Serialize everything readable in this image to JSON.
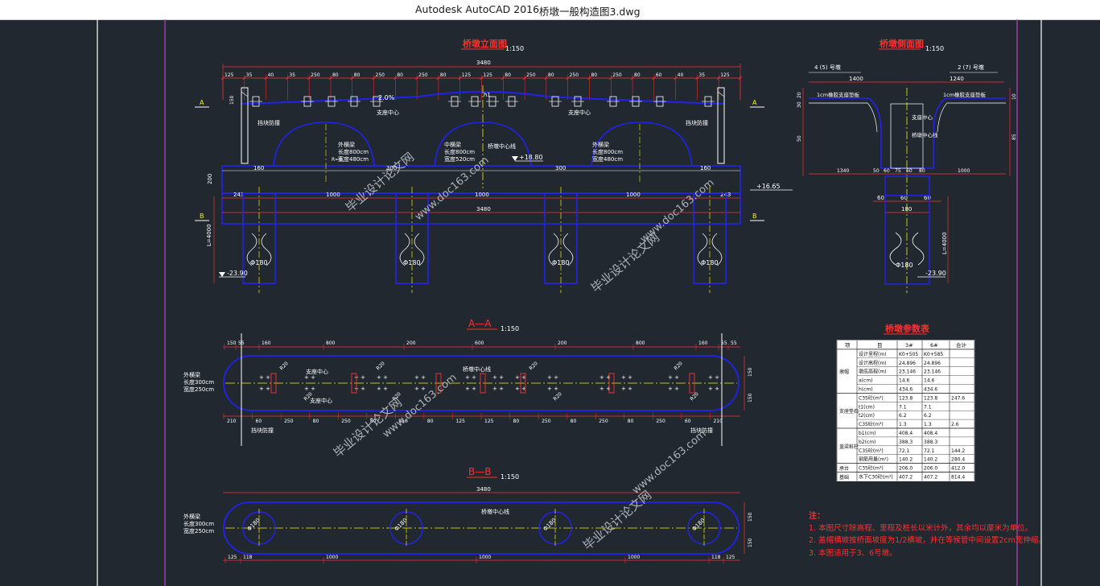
{
  "window": {
    "app_title": "Autodesk AutoCAD 2016",
    "file_name": "桥墩一般构造图3.dwg"
  },
  "drawing": {
    "front_view": {
      "title": "桥墩立面图",
      "scale": "1:150",
      "overall": "3480",
      "top_dims": [
        "125",
        "35",
        "40",
        "35",
        "250",
        "80",
        "80",
        "250",
        "80",
        "250",
        "80",
        "125",
        "125",
        "80",
        "250",
        "80",
        "250",
        "80",
        "250",
        "80",
        "60",
        "40",
        "35",
        "125"
      ],
      "beam_dims": [
        "160",
        "300",
        "300",
        "160"
      ],
      "bent_dims": [
        "243",
        "1000",
        "1000",
        "1000",
        "243"
      ],
      "overall_bottom": "3480",
      "slope": "2.0%",
      "elev_top": "+18.80",
      "elev_cap": "+16.65",
      "elev_bottom": "-23.90",
      "pile_length": "L=4000",
      "pile_dia": [
        "Φ180",
        "Φ180",
        "Φ180",
        "Φ180"
      ],
      "cap_height": "200",
      "left_dims": [
        "150",
        "200"
      ],
      "labels": {
        "guard_wall": "挡块防撞",
        "guard_wall_r": "挡块防撞",
        "support_center": "支座中心",
        "support_center_r": "支座中心",
        "pier_center": "桥墩中心线",
        "radius": "R=8",
        "bearing_a": [
          "外横梁",
          "长度800cm",
          "宽度480cm"
        ],
        "bearing_b": [
          "中横梁",
          "长度800cm",
          "宽度520cm"
        ],
        "bearing_c": [
          "外横梁",
          "长度800cm",
          "宽度480cm"
        ],
        "h1": "h1",
        "h2": "h2"
      },
      "section_marks": [
        "A",
        "A",
        "B",
        "B"
      ]
    },
    "side_view": {
      "title": "桥墩侧面图",
      "scale": "1:150",
      "left_note": "4 (5) 号墩",
      "right_note": "2 (7) 号墩",
      "top_dims": [
        "1400",
        "1240"
      ],
      "pad_left": "1cm橡胶支座垫板",
      "pad_right": "1cm橡胶支座垫板",
      "support": "支座中心",
      "pier": "桥墩中心线",
      "bottom_dims": [
        "1340",
        "50",
        "60",
        "75",
        "60",
        "80",
        "1000"
      ],
      "cap_dims": [
        "60",
        "60",
        "60"
      ],
      "pile_dim": "180",
      "heights": [
        "30",
        "20",
        "10",
        "50",
        "85"
      ],
      "pile_length": "L=4000",
      "pile_dia": "Φ180",
      "elev_bottom": "-23.90"
    },
    "section_aa": {
      "title": "A—A",
      "scale": "1:150",
      "top_dims": [
        "150",
        "55",
        "160",
        "800",
        "200",
        "600",
        "200",
        "800",
        "160",
        "55",
        "55"
      ],
      "bottom_dims": [
        "210",
        "60",
        "250",
        "80",
        "250",
        "80",
        "250",
        "80",
        "125",
        "125",
        "80",
        "250",
        "80",
        "250",
        "80",
        "250",
        "60",
        "210"
      ],
      "side_dims": [
        "150",
        "150"
      ],
      "radius": [
        "R20",
        "R20",
        "R20",
        "R20",
        "R20",
        "R20",
        "R20",
        "R20"
      ],
      "left_label": [
        "外横梁",
        "长度300cm",
        "宽度250cm"
      ],
      "support_center": "支座中心",
      "pier_center": "桥墩中心线",
      "support_note": "支座中心",
      "guard_left": "挡块防撞",
      "guard_right": "挡块防撞"
    },
    "section_bb": {
      "title": "B—B",
      "scale": "1:150",
      "overall": "3480",
      "left_label": [
        "外横梁",
        "长度300cm",
        "宽度250cm"
      ],
      "pier_center": "桥墩中心线",
      "bottom_dims": [
        "125",
        "118",
        "1000",
        "1000",
        "1000",
        "118",
        "125"
      ],
      "side_dims": [
        "150",
        "150"
      ],
      "pile_dia": [
        "Φ180",
        "Φ180",
        "Φ180",
        "Φ180"
      ]
    },
    "table": {
      "title": "桥墩参数表",
      "headers": [
        "项",
        "目",
        "3#",
        "6#",
        "合计"
      ],
      "groups": [
        {
          "name": "墩帽",
          "rows": [
            [
              "设计里程(m)",
              "K0+505",
              "K0+585",
              ""
            ],
            [
              "设计高程(m)",
              "24.896",
              "24.896",
              ""
            ],
            [
              "墩底高程(m)",
              "23.146",
              "23.146",
              ""
            ],
            [
              "a(cm)",
              "14.6",
              "14.6",
              ""
            ],
            [
              "h(cm)",
              "434.6",
              "434.6",
              ""
            ]
          ]
        },
        {
          "name": "支座垫石",
          "rows": [
            [
              "C35砼(m³)",
              "123.8",
              "123.8",
              "247.6"
            ],
            [
              "t1(cm)",
              "7.1",
              "7.1",
              ""
            ],
            [
              "t2(cm)",
              "6.2",
              "6.2",
              ""
            ],
            [
              "C35砼(m³)",
              "1.3",
              "1.3",
              "2.6"
            ]
          ]
        },
        {
          "name": "盖梁桩柱",
          "rows": [
            [
              "b1(cm)",
              "408.4",
              "408.4",
              ""
            ],
            [
              "b2(cm)",
              "388.3",
              "388.3",
              ""
            ],
            [
              "C35砼(m³)",
              "72.1",
              "72.1",
              "144.2"
            ],
            [
              "钢筋用量(m³)",
              "140.2",
              "140.2",
              "280.4"
            ]
          ]
        },
        {
          "name": "承台",
          "rows": [
            [
              "C35砼(m³)",
              "206.0",
              "206.0",
              "412.0"
            ]
          ]
        },
        {
          "name": "基础",
          "rows": [
            [
              "水下C30砼(m³)",
              "407.2",
              "407.2",
              "814.4"
            ]
          ]
        }
      ]
    },
    "notes": {
      "title": "注：",
      "items": [
        "1. 本图尺寸除高程、里程及桩长以米计外，其余均以厘米为单位。",
        "2. 盖帽横坡按桥面坡度为1/2横坡，并在等候管中间设置2cm宽伸缩。",
        "3. 本图适用于3、6号墩。"
      ]
    },
    "watermark": [
      "毕业设计论文网",
      "www.doc163.com"
    ]
  },
  "colors": {
    "background": "#212830",
    "blue": "#2222ee",
    "yellow": "#f2f200",
    "red": "#ff3030",
    "white": "#ffffff",
    "cyan": "#20c0c0",
    "magenta": "#c040c0",
    "watermark": "#9aa0a6"
  }
}
